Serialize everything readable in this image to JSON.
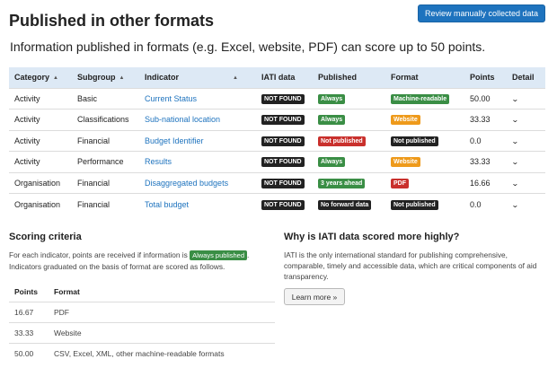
{
  "header": {
    "title": "Published in other formats",
    "review_button": "Review manually collected data",
    "subtitle": "Information published in formats (e.g. Excel, website, PDF) can score up to 50 points."
  },
  "table": {
    "headers": [
      "Category",
      "Subgroup",
      "Indicator",
      "IATI data",
      "Published",
      "Format",
      "Points",
      "Detail"
    ],
    "rows": [
      {
        "category": "Activity",
        "subgroup": "Basic",
        "indicator": "Current Status",
        "iati": "NOT FOUND",
        "published": "Always",
        "published_style": "green",
        "format": "Machine-readable",
        "format_style": "green",
        "points": "50.00"
      },
      {
        "category": "Activity",
        "subgroup": "Classifications",
        "indicator": "Sub-national location",
        "iati": "NOT FOUND",
        "published": "Always",
        "published_style": "green",
        "format": "Website",
        "format_style": "orange",
        "points": "33.33"
      },
      {
        "category": "Activity",
        "subgroup": "Financial",
        "indicator": "Budget Identifier",
        "iati": "NOT FOUND",
        "published": "Not published",
        "published_style": "red",
        "format": "Not published",
        "format_style": "dark",
        "points": "0.0"
      },
      {
        "category": "Activity",
        "subgroup": "Performance",
        "indicator": "Results",
        "iati": "NOT FOUND",
        "published": "Always",
        "published_style": "green",
        "format": "Website",
        "format_style": "orange",
        "points": "33.33"
      },
      {
        "category": "Organisation",
        "subgroup": "Financial",
        "indicator": "Disaggregated budgets",
        "iati": "NOT FOUND",
        "published": "3 years ahead",
        "published_style": "green",
        "format": "PDF",
        "format_style": "red",
        "points": "16.66"
      },
      {
        "category": "Organisation",
        "subgroup": "Financial",
        "indicator": "Total budget",
        "iati": "NOT FOUND",
        "published": "No forward data",
        "published_style": "dark",
        "format": "Not published",
        "format_style": "dark",
        "points": "0.0"
      }
    ]
  },
  "scoring": {
    "title": "Scoring criteria",
    "text_before": "For each indicator, points are received if information is",
    "badge": "Always published",
    "text_after": ". Indicators graduated on the basis of format are scored as follows.",
    "headers": [
      "Points",
      "Format"
    ],
    "rows": [
      {
        "points": "16.67",
        "format": "PDF"
      },
      {
        "points": "33.33",
        "format": "Website"
      },
      {
        "points": "50.00",
        "format": "CSV, Excel, XML, other machine-readable formats"
      }
    ]
  },
  "why": {
    "title": "Why is IATI data scored more highly?",
    "text": "IATI is the only international standard for publishing comprehensive, comparable, timely and accessible data, which are critical components of aid transparency.",
    "button": "Learn more »"
  },
  "icons": {
    "sort": "sort-up-icon",
    "detail": "chevron-down-icon"
  },
  "colors": {
    "primary": "#1e73be",
    "header_bg": "#dde9f5",
    "green": "#3a8e45",
    "red": "#c9302c",
    "orange": "#ee9a1b",
    "dark": "#222222"
  }
}
